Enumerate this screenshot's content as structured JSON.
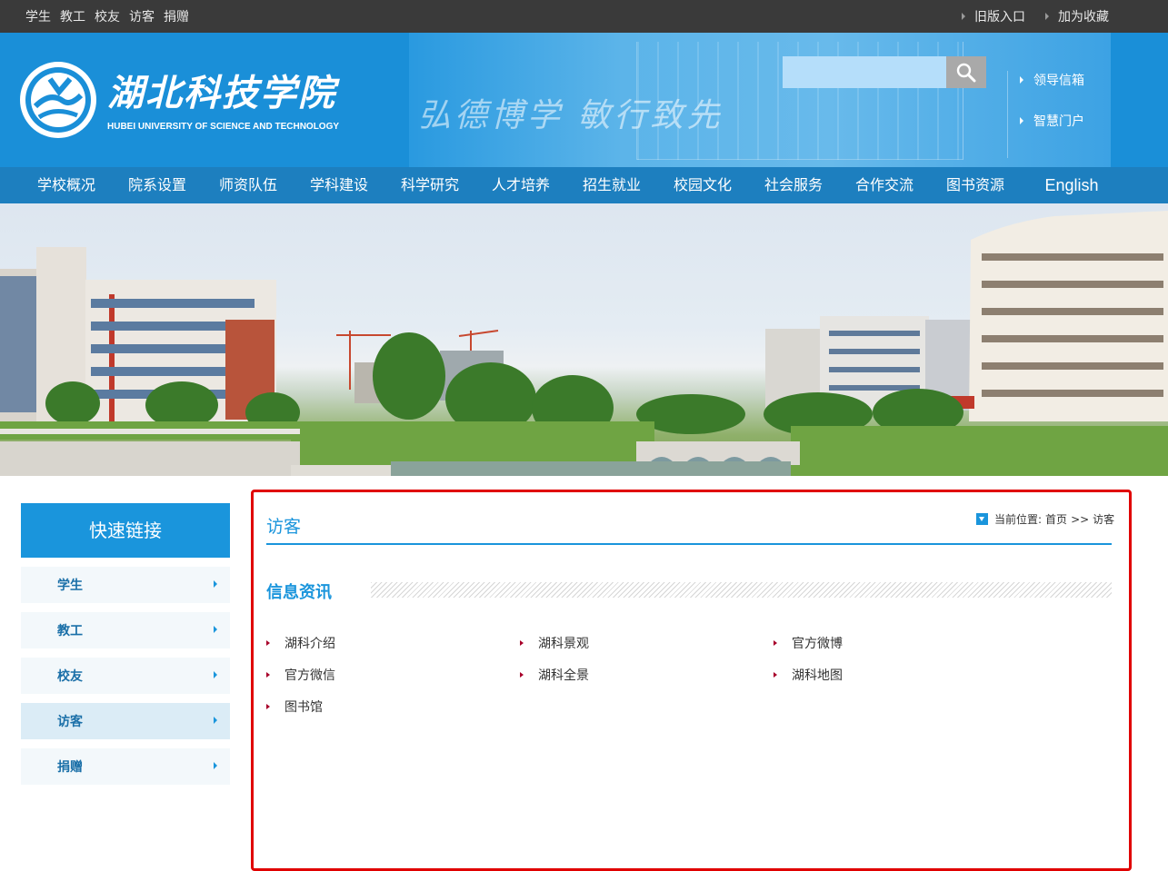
{
  "topbar": {
    "left_links": [
      "学生",
      "教工",
      "校友",
      "访客",
      "捐赠"
    ],
    "right_links": [
      "旧版入口",
      "加为收藏"
    ]
  },
  "header": {
    "logo_cn": "湖北科技学院",
    "logo_en": "HUBEI UNIVERSITY OF SCIENCE AND TECHNOLOGY",
    "motto": "弘德博学 敏行致先",
    "search_placeholder": "",
    "links": [
      "领导信箱",
      "智慧门户"
    ]
  },
  "nav": {
    "items": [
      "学校概况",
      "院系设置",
      "师资队伍",
      "学科建设",
      "科学研究",
      "人才培养",
      "招生就业",
      "校园文化",
      "社会服务",
      "合作交流",
      "图书资源",
      "English"
    ]
  },
  "sidebar": {
    "title": "快速链接",
    "items": [
      "学生",
      "教工",
      "校友",
      "访客",
      "捐赠"
    ],
    "active": "访客"
  },
  "main": {
    "heading": "访客",
    "breadcrumb_label": "当前位置:",
    "breadcrumb_home": "首页",
    "breadcrumb_sep": ">>",
    "breadcrumb_current": "访客",
    "section_title": "信息资讯",
    "links": [
      "湖科介绍",
      "湖科景观",
      "官方微博",
      "官方微信",
      "湖科全景",
      "湖科地图",
      "图书馆"
    ]
  },
  "colors": {
    "accent_blue": "#1a95dc",
    "nav_blue": "#1d7fbf",
    "topbar_dark": "#3a3a3a",
    "highlight_red": "#e00000"
  }
}
